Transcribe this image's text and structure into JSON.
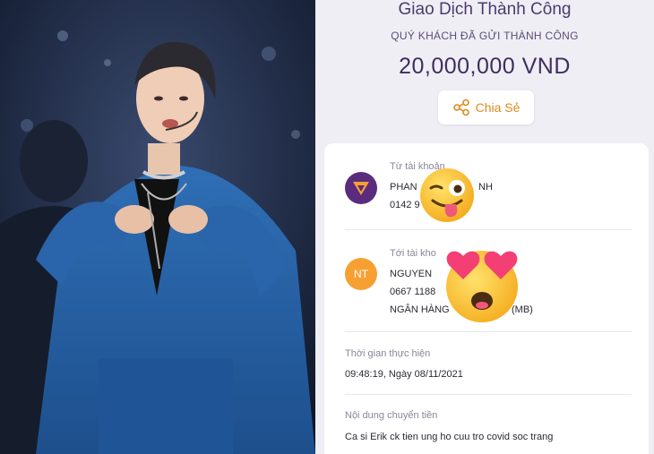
{
  "colors": {
    "accent": "#e08a1e",
    "panel_bg": "#efeef4",
    "title": "#4b3b70"
  },
  "header": {
    "title": "Giao Dịch Thành Công",
    "subtitle": "QUÝ KHÁCH ĐÃ GỬI THÀNH CÔNG",
    "amount": "20,000,000 VND"
  },
  "share": {
    "label": "Chia Sẻ",
    "icon": "share-icon"
  },
  "from": {
    "label": "Từ tài khoản",
    "name": "PHAN ",
    "name_tail": "NH",
    "account": "0142 9"
  },
  "to": {
    "label": "Tới tài kho",
    "avatar_initials": "NT",
    "name": "NGUYEN ",
    "account": "0667 1188",
    "bank": "NGÂN HÀNG ",
    "bank_tail": "(MB)"
  },
  "time": {
    "label": "Thời gian thực hiện",
    "value": "09:48:19, Ngày 08/11/2021"
  },
  "content": {
    "label": "Nội dung chuyển tiền",
    "value": "Ca si Erik ck tien ung ho cuu tro covid soc trang"
  },
  "photo": {
    "subject": "singer-photo"
  },
  "stickers": [
    "winking-tongue-emoji",
    "heart-eyes-emoji"
  ]
}
